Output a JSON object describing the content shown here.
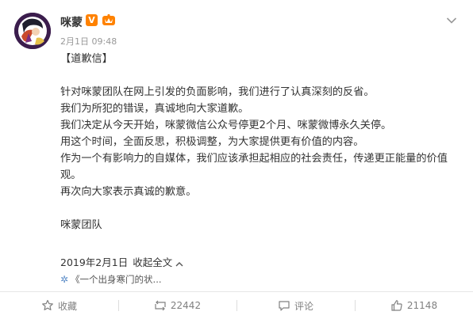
{
  "post": {
    "author": "咪蒙",
    "verified_badge": "V",
    "time": "2月1日 09:48",
    "title": "【道歉信】",
    "body": [
      "针对咪蒙团队在网上引发的负面影响，我们进行了认真深刻的反省。",
      "我们为所犯的错误，真诚地向大家道歉。",
      "我们决定从今天开始，咪蒙微信公众号停更2个月、咪蒙微博永久关停。",
      "用这个时间，全面反思，积极调整，为大家提供更有价值的内容。",
      "作为一个有影响力的自媒体，我们应该承担起相应的社会责任，传递更正能量的价值观。",
      "再次向大家表示真诚的歉意。"
    ],
    "signature": "咪蒙团队",
    "date": "2019年2月1日",
    "collapse_label": "收起全文",
    "link_text": "《一个出身寒门的状..."
  },
  "actions": {
    "favorite_label": "收藏",
    "repost_count": "22442",
    "comment_label": "评论",
    "like_count": "21148"
  },
  "colors": {
    "verified_orange": "#ff8200",
    "link_blue": "#5a8bc7",
    "text": "#333333",
    "muted": "#808080"
  }
}
